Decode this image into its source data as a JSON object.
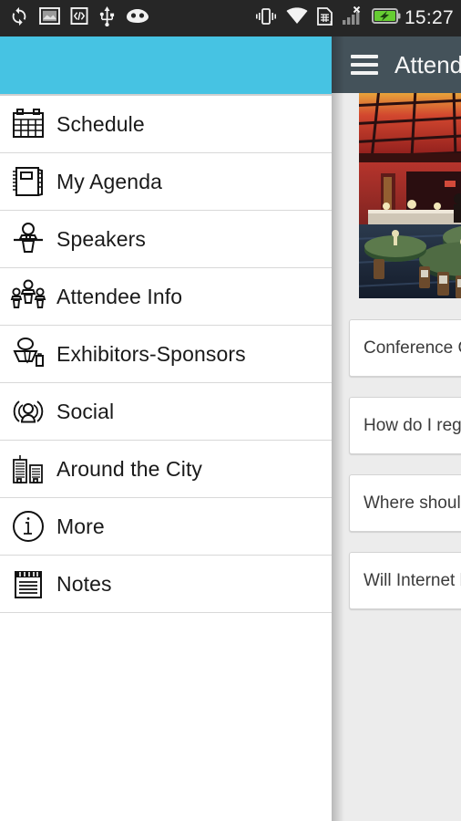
{
  "status_bar": {
    "left_icons": [
      {
        "name": "sync-icon",
        "label": "sync"
      },
      {
        "name": "screenshot-icon",
        "label": "screenshot"
      },
      {
        "name": "developer-code-icon",
        "label": "usb-debugging"
      },
      {
        "name": "usb-icon",
        "label": "usb"
      },
      {
        "name": "cyanogenmod-icon",
        "label": "cyanogenmod"
      }
    ],
    "right_icons": [
      {
        "name": "vibrate-icon",
        "label": "vibrate"
      },
      {
        "name": "wifi-icon",
        "label": "wifi"
      },
      {
        "name": "sim-card-alert-icon",
        "label": "sim-alert"
      },
      {
        "name": "no-signal-icon",
        "label": "no-service"
      },
      {
        "name": "battery-charging-icon",
        "label": "charging"
      }
    ],
    "clock": "15:27",
    "bg_color": "#262626",
    "text_color": "#f2f2f2"
  },
  "app_bar": {
    "menu_icon": "hamburger-menu-icon",
    "title": "Attendee Info",
    "bg_color": "#44525a",
    "text_color": "#f7f7f7"
  },
  "drawer": {
    "header_color": "#46c3e3",
    "bg_color": "#ffffff",
    "items": [
      {
        "icon": "calendar-icon",
        "label": "Schedule"
      },
      {
        "icon": "notebook-icon",
        "label": "My Agenda"
      },
      {
        "icon": "podium-speaker-icon",
        "label": "Speakers"
      },
      {
        "icon": "people-group-icon",
        "label": "Attendee Info"
      },
      {
        "icon": "businessperson-briefcase-icon",
        "label": "Exhibitors-Sponsors"
      },
      {
        "icon": "social-broadcast-icon",
        "label": "Social"
      },
      {
        "icon": "city-buildings-icon",
        "label": "Around the City"
      },
      {
        "icon": "info-circle-icon",
        "label": "More"
      },
      {
        "icon": "notepad-icon",
        "label": "Notes"
      }
    ]
  },
  "content": {
    "bg_color": "#ececec",
    "hero_image": {
      "name": "banquet-hall-photo",
      "alt": "Conference banquet hall with round tables"
    },
    "cards": [
      {
        "label": "Conference Center"
      },
      {
        "label": "How do I register"
      },
      {
        "label": "Where should I stay"
      },
      {
        "label": "Will Internet be available"
      }
    ],
    "card_bg": "#ffffff",
    "card_border": "#d3d3d3",
    "card_text_color": "#3b3b3b"
  }
}
